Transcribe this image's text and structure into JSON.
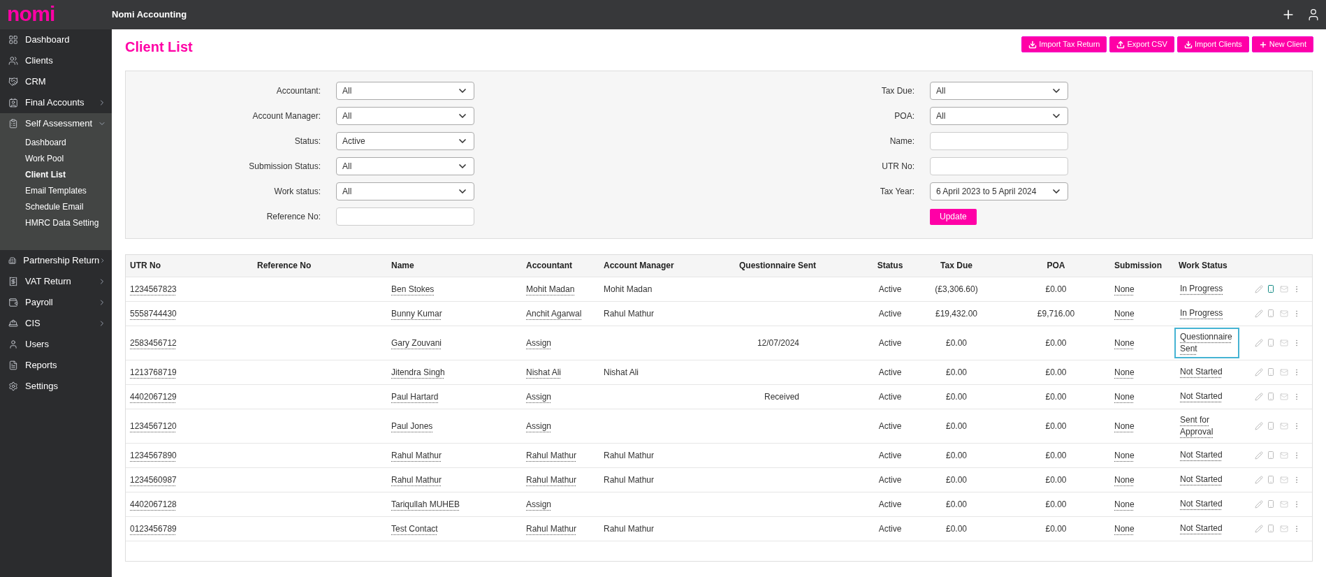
{
  "app": {
    "logo": "nomi",
    "title": "Nomi Accounting"
  },
  "sidebar": {
    "items": [
      {
        "label": "Dashboard",
        "kind": "link"
      },
      {
        "label": "Clients",
        "kind": "link"
      },
      {
        "label": "CRM",
        "kind": "link"
      },
      {
        "label": "Final Accounts",
        "kind": "group",
        "expanded": false
      },
      {
        "label": "Self Assessment",
        "kind": "group",
        "expanded": true,
        "children": [
          {
            "label": "Dashboard",
            "selected": false
          },
          {
            "label": "Work Pool",
            "selected": false
          },
          {
            "label": "Client List",
            "selected": true
          },
          {
            "label": "Email Templates",
            "selected": false
          },
          {
            "label": "Schedule Email",
            "selected": false
          },
          {
            "label": "HMRC Data Setting",
            "selected": false
          }
        ]
      },
      {
        "label": "Partnership Return",
        "kind": "group",
        "expanded": false
      },
      {
        "label": "VAT Return",
        "kind": "group",
        "expanded": false
      },
      {
        "label": "Payroll",
        "kind": "group",
        "expanded": false
      },
      {
        "label": "CIS",
        "kind": "group",
        "expanded": false
      },
      {
        "label": "Users",
        "kind": "link"
      },
      {
        "label": "Reports",
        "kind": "link"
      },
      {
        "label": "Settings",
        "kind": "link"
      }
    ]
  },
  "page_title": "Client List",
  "actions": [
    {
      "label": "Import Tax Return"
    },
    {
      "label": "Export CSV"
    },
    {
      "label": "Import Clients"
    },
    {
      "label": "New Client"
    }
  ],
  "filters": {
    "left": [
      {
        "label": "Accountant:",
        "kind": "select",
        "value": "All"
      },
      {
        "label": "Account Manager:",
        "kind": "select",
        "value": "All"
      },
      {
        "label": "Status:",
        "kind": "select",
        "value": "Active"
      },
      {
        "label": "Submission Status:",
        "kind": "select",
        "value": "All"
      },
      {
        "label": "Work status:",
        "kind": "select",
        "value": "All"
      },
      {
        "label": "Reference No:",
        "kind": "text"
      }
    ],
    "right": [
      {
        "label": "Tax Due:",
        "kind": "select",
        "value": "All"
      },
      {
        "label": "POA:",
        "kind": "select",
        "value": "All"
      },
      {
        "label": "Name:",
        "kind": "text"
      },
      {
        "label": "UTR No:",
        "kind": "text"
      },
      {
        "label": "Tax Year:",
        "kind": "select",
        "value": "6 April 2023 to 5 April 2024"
      }
    ],
    "update_button": "Update"
  },
  "table": {
    "columns": [
      "UTR No",
      "Reference No",
      "Name",
      "Accountant",
      "Account Manager",
      "Questionnaire Sent",
      "Status",
      "Tax Due",
      "POA",
      "Submission",
      "Work Status"
    ],
    "rows": [
      {
        "utr": "1234567823",
        "name": "Ben Stokes",
        "accountant": "Mohit Madan",
        "manager": "Mohit Madan",
        "status": "Active",
        "tax_due": "(£3,306.60)",
        "poa": "£0.00",
        "submission": "None",
        "work_status": "In Progress",
        "focused": false,
        "phone_active": true
      },
      {
        "utr": "5558744430",
        "name": "Bunny Kumar",
        "accountant": "Anchit Agarwal",
        "manager": "Rahul Mathur",
        "status": "Active",
        "tax_due": "£19,432.00",
        "poa": "£9,716.00",
        "submission": "None",
        "work_status": "In Progress",
        "focused": false,
        "phone_active": false
      },
      {
        "utr": "2583456712",
        "name": "Gary Zouvani",
        "accountant": "Assign",
        "questionnaire": "12/07/2024",
        "status": "Active",
        "tax_due": "£0.00",
        "poa": "£0.00",
        "submission": "None",
        "work_status": "Questionnaire Sent",
        "focused": true,
        "phone_active": false
      },
      {
        "utr": "1213768719",
        "name": "Jitendra Singh",
        "accountant": "Nishat Ali",
        "manager": "Nishat Ali",
        "status": "Active",
        "tax_due": "£0.00",
        "poa": "£0.00",
        "submission": "None",
        "work_status": "Not Started",
        "focused": false,
        "phone_active": false
      },
      {
        "utr": "4402067129",
        "name": "Paul Hartard",
        "accountant": "Assign",
        "questionnaire": "Received",
        "status": "Active",
        "tax_due": "£0.00",
        "poa": "£0.00",
        "submission": "None",
        "work_status": "Not Started",
        "focused": false,
        "phone_active": false
      },
      {
        "utr": "1234567120",
        "name": "Paul Jones",
        "accountant": "Assign",
        "status": "Active",
        "tax_due": "£0.00",
        "poa": "£0.00",
        "submission": "None",
        "work_status": "Sent for Approval",
        "focused": false,
        "phone_active": false
      },
      {
        "utr": "1234567890",
        "name": "Rahul Mathur",
        "accountant": "Rahul Mathur",
        "manager": "Rahul Mathur",
        "status": "Active",
        "tax_due": "£0.00",
        "poa": "£0.00",
        "submission": "None",
        "work_status": "Not Started",
        "focused": false,
        "phone_active": false
      },
      {
        "utr": "1234560987",
        "name": "Rahul Mathur",
        "accountant": "Rahul Mathur",
        "manager": "Rahul Mathur",
        "status": "Active",
        "tax_due": "£0.00",
        "poa": "£0.00",
        "submission": "None",
        "work_status": "Not Started",
        "focused": false,
        "phone_active": false
      },
      {
        "utr": "4402067128",
        "name": "Tariqullah MUHEB",
        "accountant": "Assign",
        "status": "Active",
        "tax_due": "£0.00",
        "poa": "£0.00",
        "submission": "None",
        "work_status": "Not Started",
        "focused": false,
        "phone_active": false
      },
      {
        "utr": "0123456789",
        "name": "Test Contact",
        "accountant": "Rahul Mathur",
        "manager": "Rahul Mathur",
        "status": "Active",
        "tax_due": "£0.00",
        "poa": "£0.00",
        "submission": "None",
        "work_status": "Not Started",
        "focused": false,
        "phone_active": false
      }
    ]
  }
}
